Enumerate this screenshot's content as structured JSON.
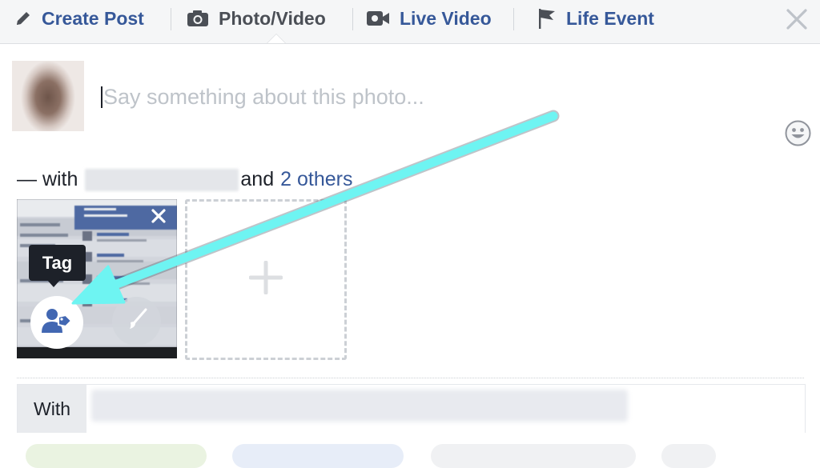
{
  "tabs": {
    "create_post": "Create Post",
    "photo_video": "Photo/Video",
    "live_video": "Live Video",
    "life_event": "Life Event"
  },
  "icons": {
    "create_post": "pencil-icon",
    "photo_video": "camera-icon",
    "live_video": "video-camera-icon",
    "life_event": "flag-icon",
    "close": "close-icon",
    "emoji": "smiley-icon",
    "remove_photo": "close-icon",
    "tag": "tag-person-icon",
    "edit": "paintbrush-icon",
    "add": "plus-icon"
  },
  "composer": {
    "placeholder": "Say something about this photo..."
  },
  "tagline": {
    "prefix": "— with",
    "connector": "and",
    "others_link": "2 others"
  },
  "photo": {
    "tooltip": "Tag"
  },
  "with_field": {
    "label": "With"
  },
  "colors": {
    "link_blue": "#365899",
    "annotation_arrow": "#6ef4f2",
    "tooltip_bg": "#1d2129"
  }
}
